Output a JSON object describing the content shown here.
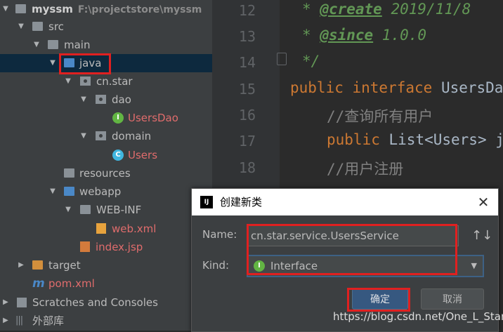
{
  "project_tree": {
    "root": {
      "name": "myssm",
      "path": "F:\\projectstore\\myssm"
    },
    "src": "src",
    "main": "main",
    "java": "java",
    "package": "cn.star",
    "dao": "dao",
    "users_dao": "UsersDao",
    "domain": "domain",
    "users": "Users",
    "resources": "resources",
    "webapp": "webapp",
    "web_inf": "WEB-INF",
    "web_xml": "web.xml",
    "index_jsp": "index.jsp",
    "target": "target",
    "pom": "pom.xml",
    "scratches": "Scratches and Consoles",
    "external_libs": "外部库"
  },
  "editor": {
    "line_numbers": [
      "12",
      "13",
      "14",
      "15",
      "16",
      "17",
      "18"
    ],
    "line12": {
      "prefix": "* ",
      "tag": "@create",
      "text": " 2019/11/8"
    },
    "line13": {
      "prefix": "* ",
      "tag": "@since",
      "text": " 1.0.0"
    },
    "line14": "*/",
    "line15": {
      "kw": "public interface ",
      "name": "UsersDa"
    },
    "line16": "//查询所有用户",
    "line17": {
      "kw": "public ",
      "text": "List<Users> j"
    },
    "line18": "//用户注册"
  },
  "dialog": {
    "title": "创建新类",
    "close_glyph": "✕",
    "name_label": "Name:",
    "name_value": "cn.star.service.UsersService",
    "sort_glyph": "↑↓",
    "kind_label": "Kind:",
    "kind_value": "Interface",
    "kind_icon": "I",
    "ok_label": "确定",
    "cancel_label": "取消"
  },
  "watermark": "https://blog.csdn.net/One_L_Star",
  "colors": {
    "tree_bg": "#3c3f41",
    "editor_bg": "#2b2b2b",
    "selection": "#0d293e",
    "highlight_box": "#e02020",
    "interface_icon": "#62b543",
    "class_icon": "#40b6e0"
  }
}
